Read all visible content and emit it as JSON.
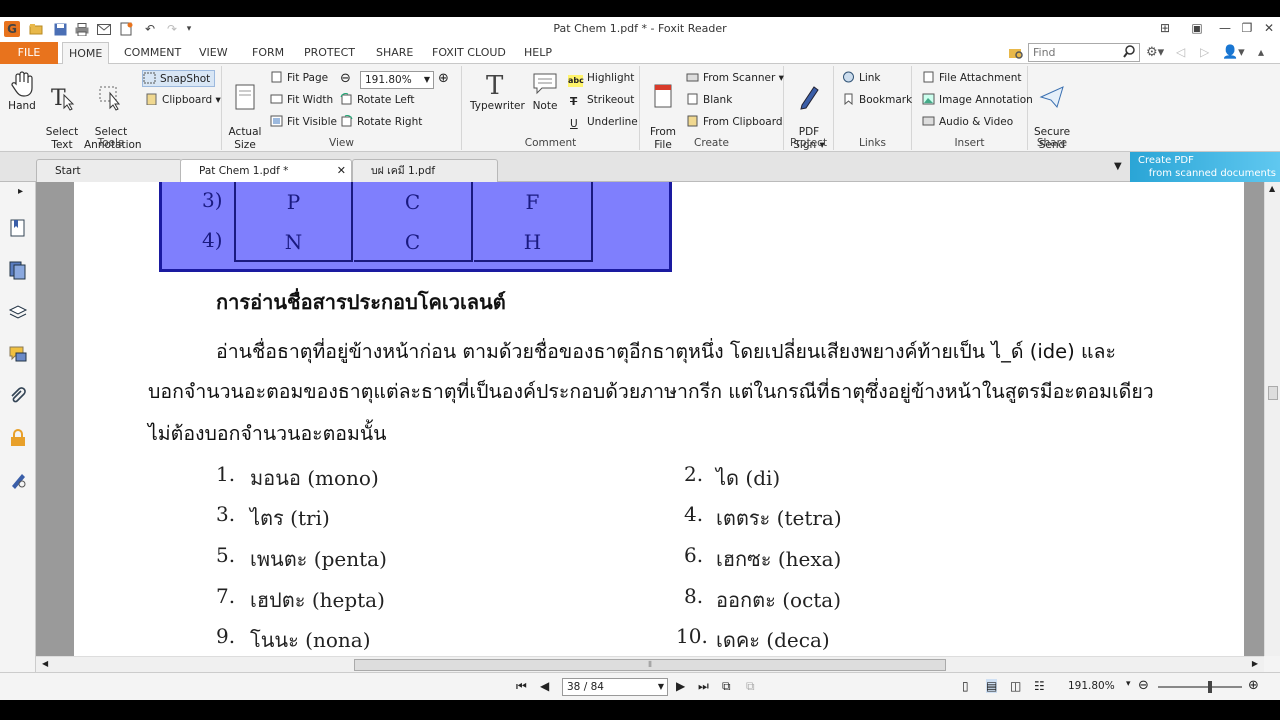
{
  "window": {
    "title": "Pat Chem 1.pdf * - Foxit Reader",
    "app_icon": "foxit-app-icon",
    "controls": [
      "minimize",
      "restore",
      "close"
    ]
  },
  "menu_tabs": [
    "FILE",
    "HOME",
    "COMMENT",
    "VIEW",
    "FORM",
    "PROTECT",
    "SHARE",
    "FOXIT CLOUD",
    "HELP"
  ],
  "active_menu_tab": "HOME",
  "search": {
    "placeholder": "Find",
    "value": ""
  },
  "ribbon": {
    "tools": {
      "label": "Tools",
      "hand": "Hand",
      "select_text": "Select\nText",
      "select_annotation": "Select\nAnnotation",
      "snapshot": "SnapShot",
      "clipboard": "Clipboard"
    },
    "view": {
      "label": "View",
      "actual_size": "Actual\nSize",
      "fit_page": "Fit Page",
      "fit_width": "Fit Width",
      "fit_visible": "Fit Visible",
      "zoom": "191.80%",
      "rotate_left": "Rotate Left",
      "rotate_right": "Rotate Right"
    },
    "comment": {
      "label": "Comment",
      "typewriter": "Typewriter",
      "note": "Note",
      "highlight": "Highlight",
      "strikeout": "Strikeout",
      "underline": "Underline"
    },
    "create": {
      "label": "Create",
      "from_file": "From\nFile",
      "from_scanner": "From Scanner",
      "blank": "Blank",
      "from_clipboard": "From Clipboard"
    },
    "protect": {
      "label": "Protect",
      "pdf_sign": "PDF\nSign"
    },
    "links": {
      "label": "Links",
      "link": "Link",
      "bookmark": "Bookmark"
    },
    "insert": {
      "label": "Insert",
      "file_attachment": "File Attachment",
      "image_annotation": "Image Annotation",
      "audio_video": "Audio & Video"
    },
    "share": {
      "label": "Share",
      "secure_send": "Secure\nSend"
    }
  },
  "doc_tabs": [
    {
      "label": "Start",
      "active": false
    },
    {
      "label": "Pat Chem 1.pdf *",
      "active": true
    },
    {
      "label": "บฝ เคมี 1.pdf",
      "active": false
    }
  ],
  "promo": {
    "line1": "Create PDF",
    "line2": "from scanned documents"
  },
  "document": {
    "table_rows": [
      {
        "num": "3)",
        "cells": [
          "P",
          "C",
          "F"
        ]
      },
      {
        "num": "4)",
        "cells": [
          "N",
          "C",
          "H"
        ]
      }
    ],
    "heading": "การอ่านชื่อสารประกอบโคเวเลนต์",
    "para_line1": "อ่านชื่อธาตุที่อยู่ข้างหน้าก่อน  ตามด้วยชื่อของธาตุอีกธาตุหนึ่ง  โดยเปลี่ยนเสียงพยางค์ท้ายเป็น  ไ_ด์  (ide)  และ",
    "para_line2": "บอกจำนวนอะตอมของธาตุแต่ละธาตุที่เป็นองค์ประกอบด้วยภาษากรีก  แต่ในกรณีที่ธาตุซึ่งอยู่ข้างหน้าในสูตรมีอะตอมเดียว",
    "para_line3": "ไม่ต้องบอกจำนวนอะตอมนั้น",
    "prefixes": [
      {
        "num": "1.",
        "text": "มอนอ (mono)"
      },
      {
        "num": "2.",
        "text": "ได (di)"
      },
      {
        "num": "3.",
        "text": "ไตร (tri)"
      },
      {
        "num": "4.",
        "text": "เตตระ (tetra)"
      },
      {
        "num": "5.",
        "text": "เพนตะ (penta)"
      },
      {
        "num": "6.",
        "text": "เฮกซะ (hexa)"
      },
      {
        "num": "7.",
        "text": "เฮปตะ (hepta)"
      },
      {
        "num": "8.",
        "text": "ออกตะ (octa)"
      },
      {
        "num": "9.",
        "text": "โนนะ (nona)"
      },
      {
        "num": "10.",
        "text": "เดคะ (deca)"
      }
    ]
  },
  "status": {
    "page": "38 / 84",
    "zoom": "191.80%"
  },
  "colors": {
    "accent": "#e8731d",
    "table_fill": "#7f7ffd",
    "table_border": "#1a1aa0"
  }
}
